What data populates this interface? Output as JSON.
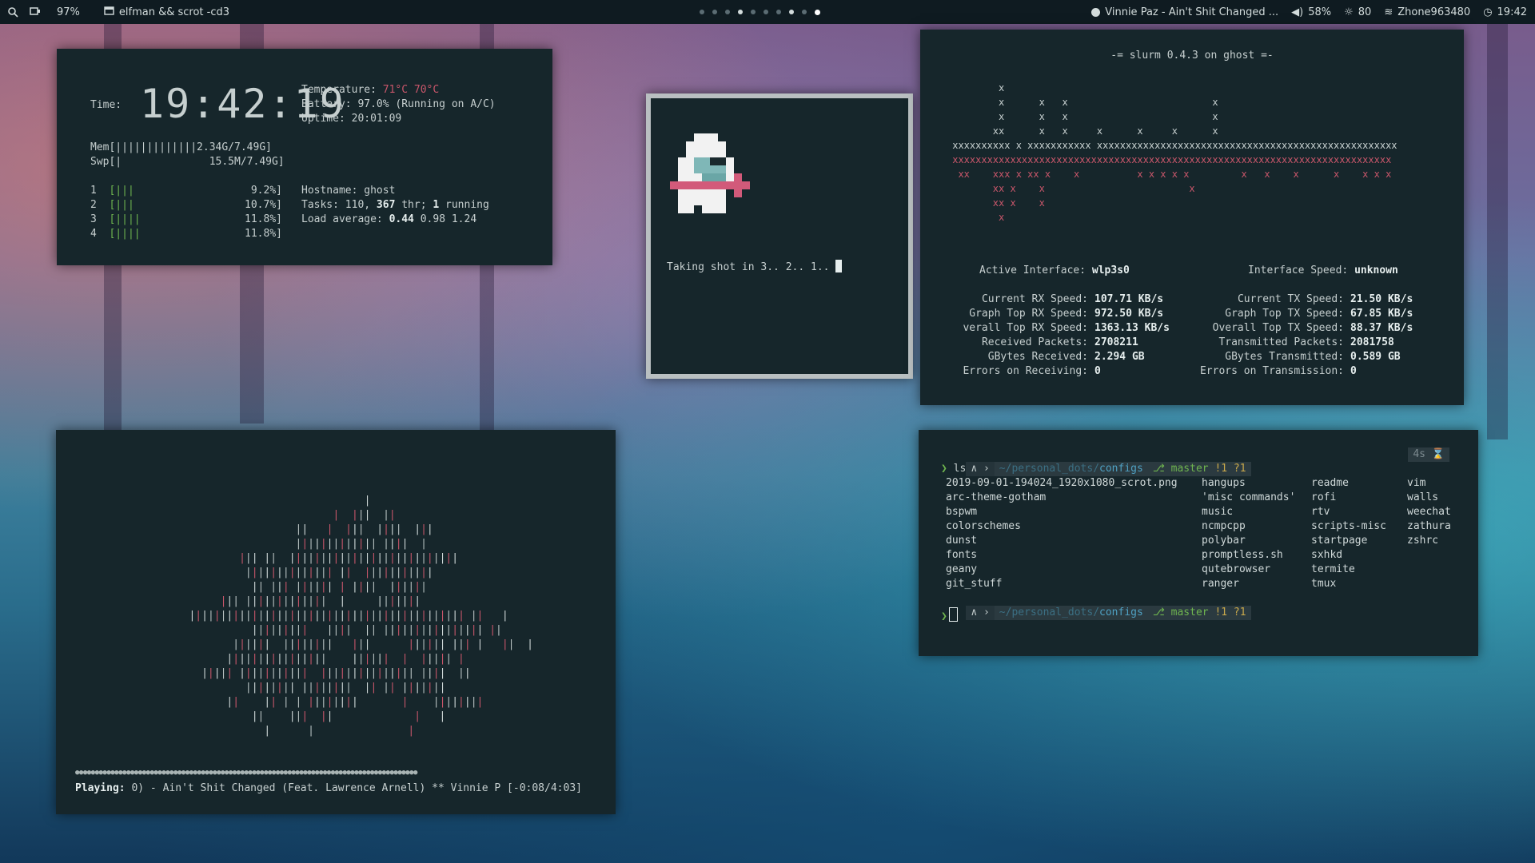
{
  "topbar": {
    "battery": "97%",
    "window_title": "elfman && scrot -cd3",
    "music": "Vinnie Paz - Ain't Shit Changed ...",
    "volume": "58%",
    "brightness": "80",
    "wifi": "Zhone963480",
    "time": "19:42",
    "icons": [
      "search-icon",
      "battery-icon",
      "window-icon",
      "music-icon",
      "volume-icon",
      "brightness-icon",
      "wifi-icon",
      "clock-icon"
    ],
    "workspaces": [
      false,
      false,
      false,
      true,
      false,
      false,
      false,
      true,
      false,
      true
    ]
  },
  "htop": {
    "time_label": "Time:",
    "clock": "19:42:19",
    "temp_label": "Temperature:",
    "temp1": "71°C",
    "temp2": "70°C",
    "battery": "Battery: 97.0% (Running on A/C)",
    "uptime": "Uptime: 20:01:09",
    "mem_bar": "Mem[|||||||||||||2.34G/7.49G]",
    "swp_bar": "Swp[|              15.5M/7.49G]",
    "cpus": [
      {
        "n": "1",
        "bar": "[|||",
        "pct": "9.2%]"
      },
      {
        "n": "2",
        "bar": "[|||",
        "pct": "10.7%]"
      },
      {
        "n": "3",
        "bar": "[||||",
        "pct": "11.8%]"
      },
      {
        "n": "4",
        "bar": "[||||",
        "pct": "11.8%]"
      }
    ],
    "hostname": "Hostname: ghost",
    "tasks_pre": "Tasks: 110, ",
    "tasks_thr": "367",
    "tasks_mid": " thr; ",
    "tasks_run": "1",
    "tasks_post": " running",
    "load_pre": "Load average: ",
    "load1": "0.44",
    "load_rest": " 0.98 1.24"
  },
  "scrot": {
    "text": "Taking shot in 3.. 2.. 1.. "
  },
  "slurm": {
    "title": "-= slurm 0.4.3 on ghost =-",
    "graph_top": "         x\n         x      x   x                         x\n         x      x   x                         x\n        xx      x   x     x      x     x      x\n xxxxxxxxxx x xxxxxxxxxxx xxxxxxxxxxxxxxxxxxxxxxxxxxxxxxxxxxxxxxxxxxxxxxxxxxxx",
    "graph_bottom": " xxxxxxxxxxxxxxxxxxxxxxxxxxxxxxxxxxxxxxxxxxxxxxxxxxxxxxxxxxxxxxxxxxxxxxxxxxxx\n  xx    xxx x xx x    x          x x x x x         x   x    x      x    x x x\n        xx x    x                         x\n        xx x    x\n         x",
    "active_label": "Active Interface:",
    "active_val": "wlp3s0",
    "speed_label": "Interface Speed:",
    "speed_val": "unknown",
    "rx": [
      {
        "l": "Current RX Speed:",
        "v": "107.71 KB/s"
      },
      {
        "l": "Graph Top RX Speed:",
        "v": "972.50 KB/s"
      },
      {
        "l": "verall Top RX Speed:",
        "v": "1363.13 KB/s"
      },
      {
        "l": "Received Packets:",
        "v": "2708211"
      },
      {
        "l": "GBytes Received:",
        "v": "2.294 GB"
      },
      {
        "l": "Errors on Receiving:",
        "v": "0"
      }
    ],
    "tx": [
      {
        "l": "Current TX Speed:",
        "v": "21.50 KB/s"
      },
      {
        "l": "Graph Top TX Speed:",
        "v": "67.85 KB/s"
      },
      {
        "l": "Overall Top TX Speed:",
        "v": "88.37 KB/s"
      },
      {
        "l": "Transmitted Packets:",
        "v": "2081758"
      },
      {
        "l": "GBytes Transmitted:",
        "v": "0.589 GB"
      },
      {
        "l": "Errors on Transmission:",
        "v": "0"
      }
    ]
  },
  "cava": {
    "viz": "                                     |\n                                |  |||  ||\n                          ||   |  |||  ||||  |||\n                          ||||||||||||| ||||  |\n                 ||| ||  |||||||||||||||||||||||||||\n                  |||||||||||||| ||  |||||||||||\n                   || ||| |||||| | ||||  ||||||\n              ||| |||||||||||||  |     |||||||\n         |||||||||||||||||||||||||||||||||||||||||||| ||   |\n                   |||||||||   ||||  || |||||||||||||||| ||\n                ||||||  ||||||||   |||      |||||| ||| |   ||  |\n               ||||||||||||||||    ||||||  |  ||||| |\n           ||||| |||||||||||  ||||||||||||||| ||||  ||\n                  |||||||| ||||||||  || || |||||||\n               ||    || | | ||||||||       |    ||||||||\n                   ||    |||  ||             |   |\n                     |      |               |",
    "dots": "●●●●●●●●●●●●●●●●●●●●●●●●●●●●●●●●●●●●●●●●●●●●●●●●●●●●●●●●●●●●●●●●●●●●●●●●●●●●●●●●●●●●●●●",
    "playing_label": "Playing:",
    "playing_text": " 0) - Ain't Shit Changed (Feat. Lawrence Arnell) ** Vinnie P [-0:08/4:03]"
  },
  "terminal": {
    "prompt_path_dim": "~/personal_dots/",
    "prompt_path_dir": "configs",
    "branch": "master",
    "status": "!1 ?1",
    "elapsed": "4s",
    "command": "ls",
    "cols": [
      [
        "2019-09-01-194024_1920x1080_scrot.png",
        "arc-theme-gotham",
        "bspwm",
        "colorschemes",
        "dunst",
        "fonts",
        "geany",
        "git_stuff"
      ],
      [
        "hangups",
        "'misc commands'",
        "music",
        "ncmpcpp",
        "polybar",
        "promptless.sh",
        "qutebrowser",
        "ranger"
      ],
      [
        "readme",
        "rofi",
        "rtv",
        "scripts-misc",
        "startpage",
        "sxhkd",
        "termite",
        "tmux"
      ],
      [
        "vim",
        "walls",
        "weechat",
        "zathura",
        "zshrc"
      ]
    ]
  }
}
